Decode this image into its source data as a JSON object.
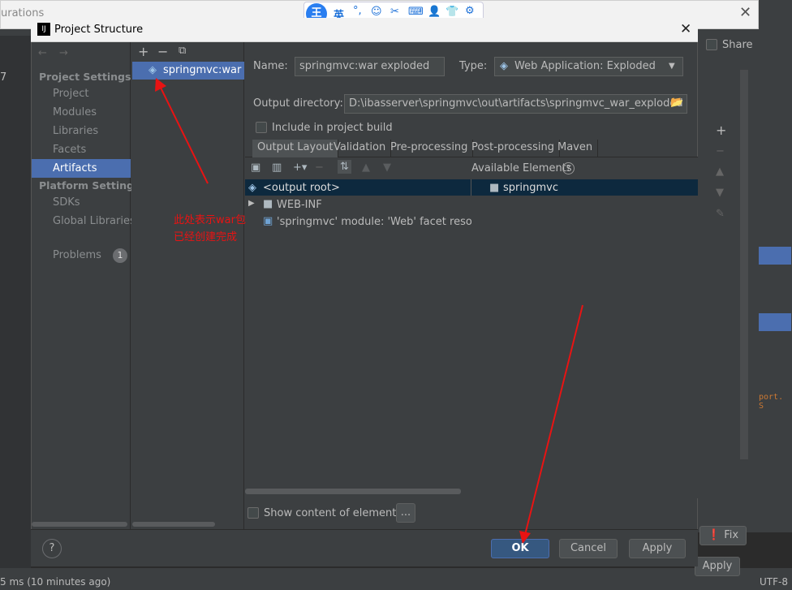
{
  "background": {
    "behind_title": "urations",
    "share_label": "Share",
    "fix_label": "Fix",
    "apply_label": "Apply",
    "left_number": "7",
    "code_fragment": "port. S",
    "status_left": "5 ms (10 minutes ago)",
    "status_right": "UTF-8"
  },
  "ime_toolbar": {
    "logo": "王",
    "lang": "英",
    "icons": [
      "punctuation-icon",
      "emoji-icon",
      "scissors-icon",
      "keyboard-icon",
      "user-icon",
      "shirt-icon",
      "gear-icon"
    ]
  },
  "dialog": {
    "title": "Project Structure",
    "nav": {
      "project_settings_header": "Project Settings",
      "items_project": [
        "Project",
        "Modules",
        "Libraries",
        "Facets",
        "Artifacts"
      ],
      "platform_settings_header": "Platform Settings",
      "items_platform": [
        "SDKs",
        "Global Libraries"
      ],
      "problems_label": "Problems",
      "problems_count": "1",
      "selected": "Artifacts"
    },
    "artifact_list": {
      "items": [
        "springmvc:war exploded"
      ]
    },
    "name_label": "Name:",
    "name_value": "springmvc:war exploded",
    "type_label": "Type:",
    "type_value": "Web Application: Exploded",
    "output_dir_label": "Output directory:",
    "output_dir_value": "D:\\ibasserver\\springmvc\\out\\artifacts\\springmvc_war_exploded",
    "include_build_label": "Include in project build",
    "tabs": [
      "Output Layout",
      "Validation",
      "Pre-processing",
      "Post-processing",
      "Maven"
    ],
    "active_tab": "Output Layout",
    "available_elements_label": "Available Elements",
    "layout_tree": [
      "<output root>",
      "WEB-INF",
      "'springmvc' module: 'Web' facet resource"
    ],
    "available_tree": [
      "springmvc"
    ],
    "show_content_label": "Show content of elements",
    "ellipsis_label": "...",
    "ok_label": "OK",
    "cancel_label": "Cancel",
    "apply_label": "Apply",
    "help_label": "?"
  },
  "annotation": {
    "note_line1": "此处表示war包",
    "note_line2": "已经创建完成",
    "color": "#e81313"
  },
  "colors": {
    "selection": "#4b6eaf",
    "panel": "#3c3f41",
    "tree_selection": "#0d293e"
  }
}
